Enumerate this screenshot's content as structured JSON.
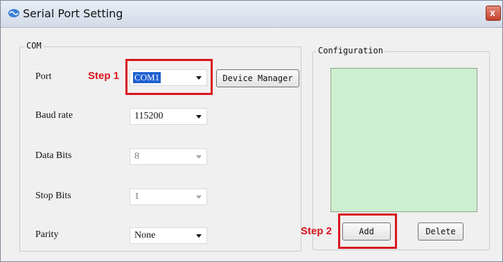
{
  "window": {
    "title": "Serial Port Setting",
    "close_label": "x"
  },
  "com_group": {
    "legend": "COM",
    "fields": [
      {
        "label": "Port",
        "value": "COM1",
        "enabled": true
      },
      {
        "label": "Baud rate",
        "value": "115200",
        "enabled": true
      },
      {
        "label": "Data Bits",
        "value": "8",
        "enabled": false
      },
      {
        "label": "Stop Bits",
        "value": "1",
        "enabled": false
      },
      {
        "label": "Parity",
        "value": "None",
        "enabled": true
      }
    ],
    "device_manager_label": "Device Manager"
  },
  "configuration_group": {
    "legend": "Configuration",
    "add_label": "Add",
    "delete_label": "Delete"
  },
  "annotations": {
    "step1": "Step 1",
    "step2": "Step 2",
    "color": "#d8131d"
  },
  "colors": {
    "list_background": "#ccefd0",
    "selection": "#1f5fd0"
  }
}
